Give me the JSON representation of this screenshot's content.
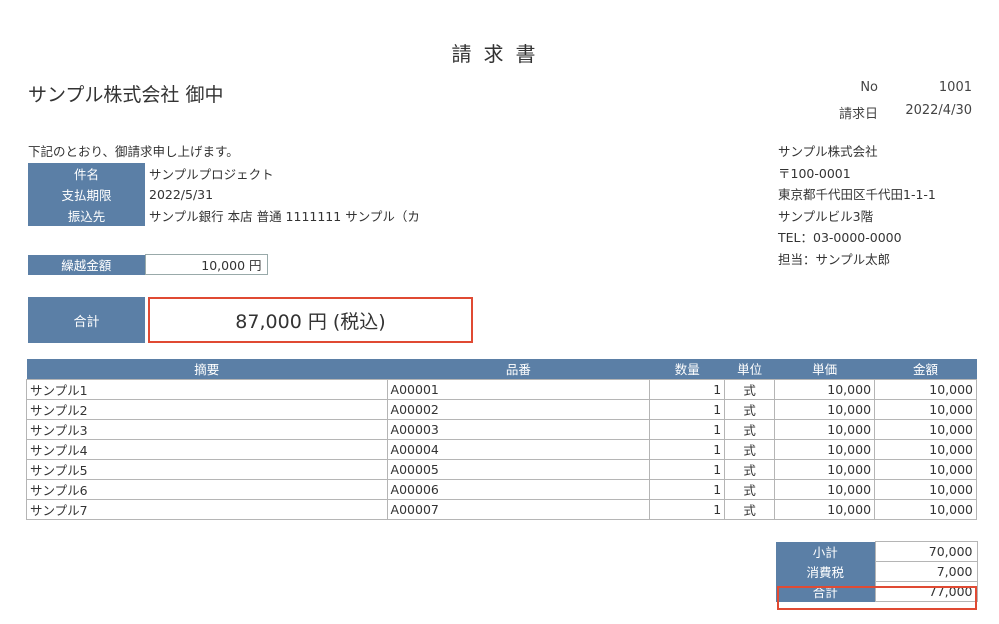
{
  "header": {
    "title": "請求書",
    "client": "サンプル株式会社 御中",
    "no_label": "No",
    "no_value": "1001",
    "date_label": "請求日",
    "date_value": "2022/4/30"
  },
  "intro": "下記のとおり、御請求申し上げます。",
  "info": [
    {
      "label": "件名",
      "value": "サンプルプロジェクト"
    },
    {
      "label": "支払期限",
      "value": "2022/5/31"
    },
    {
      "label": "振込先",
      "value": "サンプル銀行 本店 普通 1111111 サンプル（カ"
    }
  ],
  "carry": {
    "label": "繰越金額",
    "value": "10,000 円"
  },
  "total": {
    "label": "合計",
    "value": "87,000 円 (税込)"
  },
  "company": {
    "name": "サンプル株式会社",
    "postal": "〒100-0001",
    "address": "東京都千代田区千代田1-1-1",
    "building": "サンプルビル3階",
    "tel": "TEL：03-0000-0000",
    "contact": "担当：サンプル太郎"
  },
  "items": {
    "headers": [
      "摘要",
      "品番",
      "数量",
      "単位",
      "単価",
      "金額"
    ],
    "rows": [
      [
        "サンプル1",
        "A00001",
        "1",
        "式",
        "10,000",
        "10,000"
      ],
      [
        "サンプル2",
        "A00002",
        "1",
        "式",
        "10,000",
        "10,000"
      ],
      [
        "サンプル3",
        "A00003",
        "1",
        "式",
        "10,000",
        "10,000"
      ],
      [
        "サンプル4",
        "A00004",
        "1",
        "式",
        "10,000",
        "10,000"
      ],
      [
        "サンプル5",
        "A00005",
        "1",
        "式",
        "10,000",
        "10,000"
      ],
      [
        "サンプル6",
        "A00006",
        "1",
        "式",
        "10,000",
        "10,000"
      ],
      [
        "サンプル7",
        "A00007",
        "1",
        "式",
        "10,000",
        "10,000"
      ]
    ]
  },
  "summary": [
    {
      "label": "小計",
      "value": "70,000"
    },
    {
      "label": "消費税",
      "value": "7,000"
    },
    {
      "label": "合計",
      "value": "77,000"
    }
  ]
}
